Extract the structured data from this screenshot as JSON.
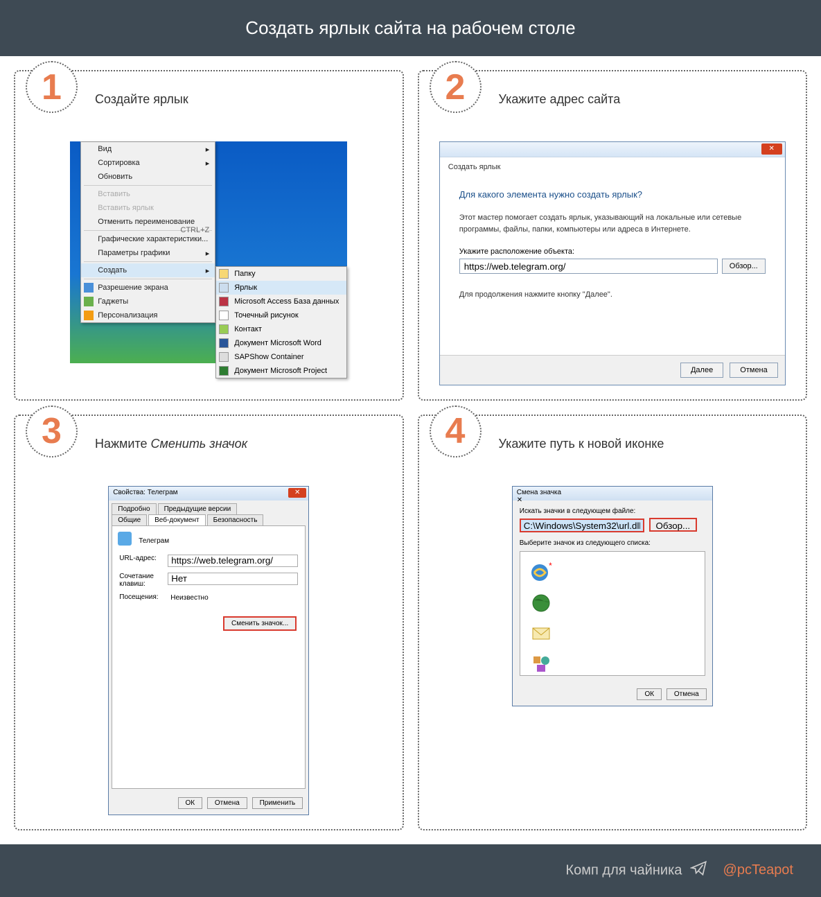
{
  "header": {
    "title": "Создать ярлык сайта на рабочем столе"
  },
  "steps": {
    "s1": {
      "num": "1",
      "title": "Создайте ярлык"
    },
    "s2": {
      "num": "2",
      "title": "Укажите адрес сайта"
    },
    "s3": {
      "num": "3",
      "title_pre": "Нажмите ",
      "title_em": "Сменить значок"
    },
    "s4": {
      "num": "4",
      "title": "Укажите путь к новой иконке"
    }
  },
  "ctx": {
    "items": [
      "Вид",
      "Сортировка",
      "Обновить",
      "Вставить",
      "Вставить ярлык",
      "Отменить переименование",
      "Графические характеристики...",
      "Параметры графики",
      "Создать",
      "Разрешение экрана",
      "Гаджеты",
      "Персонализация"
    ],
    "shortcut": "CTRL+Z",
    "arrow": "▸"
  },
  "sub": {
    "items": [
      "Папку",
      "Ярлык",
      "Microsoft Access База данных",
      "Точечный рисунок",
      "Контакт",
      "Документ Microsoft Word",
      "SAPShow Container",
      "Документ Microsoft Project"
    ]
  },
  "wiz": {
    "crumb": "Создать ярлык",
    "close": "✕",
    "question": "Для какого элемента нужно создать ярлык?",
    "hint": "Этот мастер помогает создать ярлык, указывающий на локальные или сетевые программы, файлы, папки, компьютеры или адреса в Интернете.",
    "locLabel": "Укажите расположение объекта:",
    "url": "https://web.telegram.org/",
    "browse": "Обзор...",
    "continue": "Для продолжения нажмите кнопку \"Далее\".",
    "next": "Далее",
    "cancel": "Отмена"
  },
  "props": {
    "winTitle": "Свойства: Телеграм",
    "close": "✕",
    "tabs": [
      "Подробно",
      "Предыдущие версии",
      "Общие",
      "Веб-документ",
      "Безопасность"
    ],
    "name": "Телеграм",
    "urlLabel": "URL-адрес:",
    "url": "https://web.telegram.org/",
    "hotkeyLabel": "Сочетание клавиш:",
    "hotkey": "Нет",
    "visitsLabel": "Посещения:",
    "visits": "Неизвестно",
    "changeIcon": "Сменить значок...",
    "ok": "ОК",
    "cancel": "Отмена",
    "apply": "Применить"
  },
  "picker": {
    "winTitle": "Смена значка",
    "close": "✕",
    "searchLabel": "Искать значки в следующем файле:",
    "path": "C:\\Windows\\System32\\url.dll",
    "browse": "Обзор...",
    "listLabel": "Выберите значок из следующего списка:",
    "ok": "ОК",
    "cancel": "Отмена"
  },
  "footer": {
    "text": "Комп для чайника",
    "handle": "@pcTeapot"
  }
}
